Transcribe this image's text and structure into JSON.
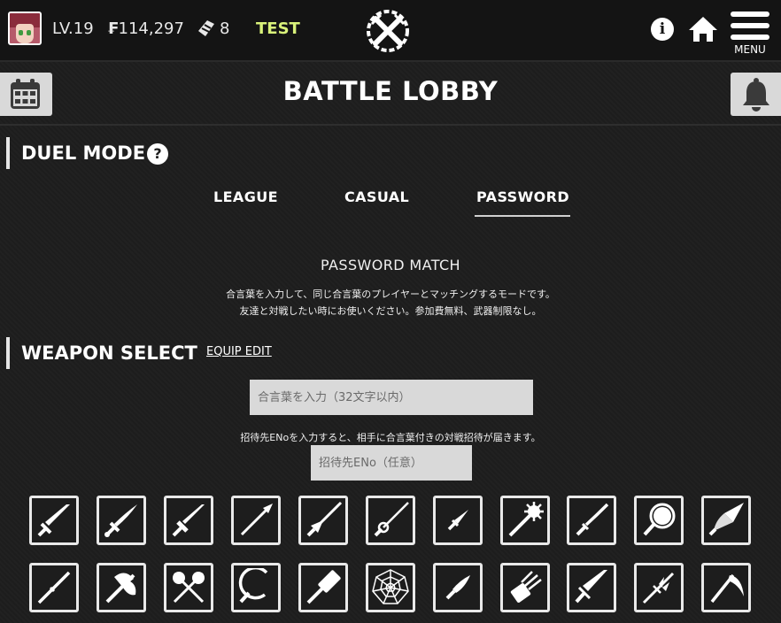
{
  "topbar": {
    "level": "LV.19",
    "money": "114,297",
    "money_symbol": "₣",
    "tickets": "8",
    "server_label": "TEST",
    "menu_label": "MENU",
    "info_glyph": "i",
    "icons": [
      "avatar",
      "money-icon",
      "ticket-icon",
      "logo-swords-icon",
      "info-icon",
      "home-icon",
      "hamburger-menu-icon"
    ]
  },
  "header": {
    "title": "BATTLE LOBBY",
    "left_icon": "calendar-icon",
    "right_icon": "bell-icon"
  },
  "duel": {
    "section_title": "DUEL MODE",
    "help_glyph": "?",
    "tabs": [
      "LEAGUE",
      "CASUAL",
      "PASSWORD"
    ],
    "active_tab": "PASSWORD",
    "mode_title": "PASSWORD MATCH",
    "desc_line1": "合言葉を入力して、同じ合言葉のプレイヤーとマッチングするモードです。",
    "desc_line2": "友達と対戦したい時にお使いください。参加費無料、武器制限なし。"
  },
  "weapon": {
    "section_title": "WEAPON SELECT",
    "equip_edit": "EQUIP EDIT",
    "password_placeholder": "合言葉を入力（32文字以内）",
    "password_value": "",
    "invite_text": "招待先ENoを入力すると、相手に合言葉付きの対戦招待が届きます。",
    "eno_placeholder": "招待先ENo（任意）",
    "eno_value": "",
    "row1": [
      "sword-icon",
      "curved-sword-icon",
      "long-sword-icon",
      "spear-icon",
      "lance-icon",
      "rapier-icon",
      "dagger-icon",
      "morning-star-icon",
      "katana-icon",
      "magnifier-icon",
      "drill-lance-icon"
    ],
    "row2": [
      "staff-icon",
      "axe-icon",
      "double-axe-icon",
      "sickle-icon",
      "hammer-icon",
      "spider-web-icon",
      "knife-icon",
      "claw-icon",
      "great-sword-icon",
      "trident-icon",
      "scythe-icon"
    ]
  },
  "colors": {
    "background": "#1d1d1d",
    "topbar": "#141414",
    "accent_test": "#d9f27a",
    "button_grey": "#d9d9d9",
    "border_white": "#e9e9e9"
  }
}
